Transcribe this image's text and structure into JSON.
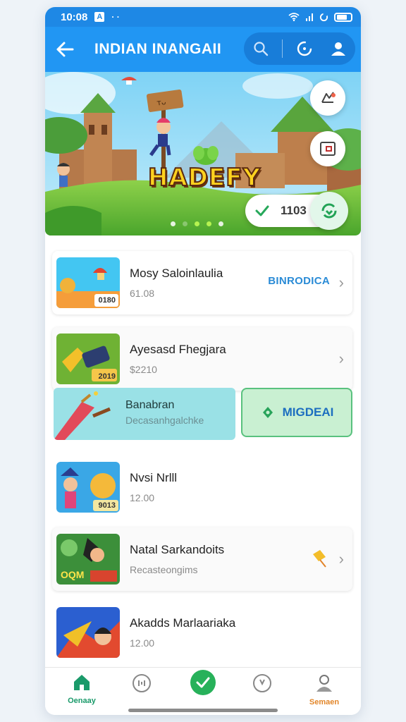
{
  "status_bar": {
    "time": "10:08",
    "badge": "A",
    "dots": "· ·"
  },
  "app_bar": {
    "title": "INDIAN INANGAII"
  },
  "banner": {
    "logo_text": "HADEFY",
    "pill_value": "1103",
    "slides_total": 5,
    "active_slide": [
      2,
      3
    ]
  },
  "list": {
    "items": [
      {
        "title": "Mosy Saloinlaulia",
        "subtitle": "61.08",
        "link": "BINRODICA",
        "thumb_label": "0180"
      },
      {
        "title": "Ayesasd Fhegjara",
        "subtitle": "$2210",
        "thumb_label": "2019"
      },
      {
        "title": "Nvsi Nrlll",
        "subtitle": "12.00",
        "thumb_label": "9013"
      },
      {
        "title": "Natal Sarkandoits",
        "subtitle": "Recasteongims",
        "thumb_label": "OQM"
      },
      {
        "title": "Akadds Marlaariaka",
        "subtitle": "12.00"
      }
    ],
    "promo": {
      "title": "Banabran",
      "subtitle": "Decasanhgalchke",
      "action_label": "MIGDEAI"
    }
  },
  "bottom_nav": {
    "home_label": "Oenaay",
    "profile_label": "Semaen"
  },
  "colors": {
    "primary": "#2196f3",
    "accent_green": "#27b15a",
    "link_blue": "#2a8bd6"
  }
}
